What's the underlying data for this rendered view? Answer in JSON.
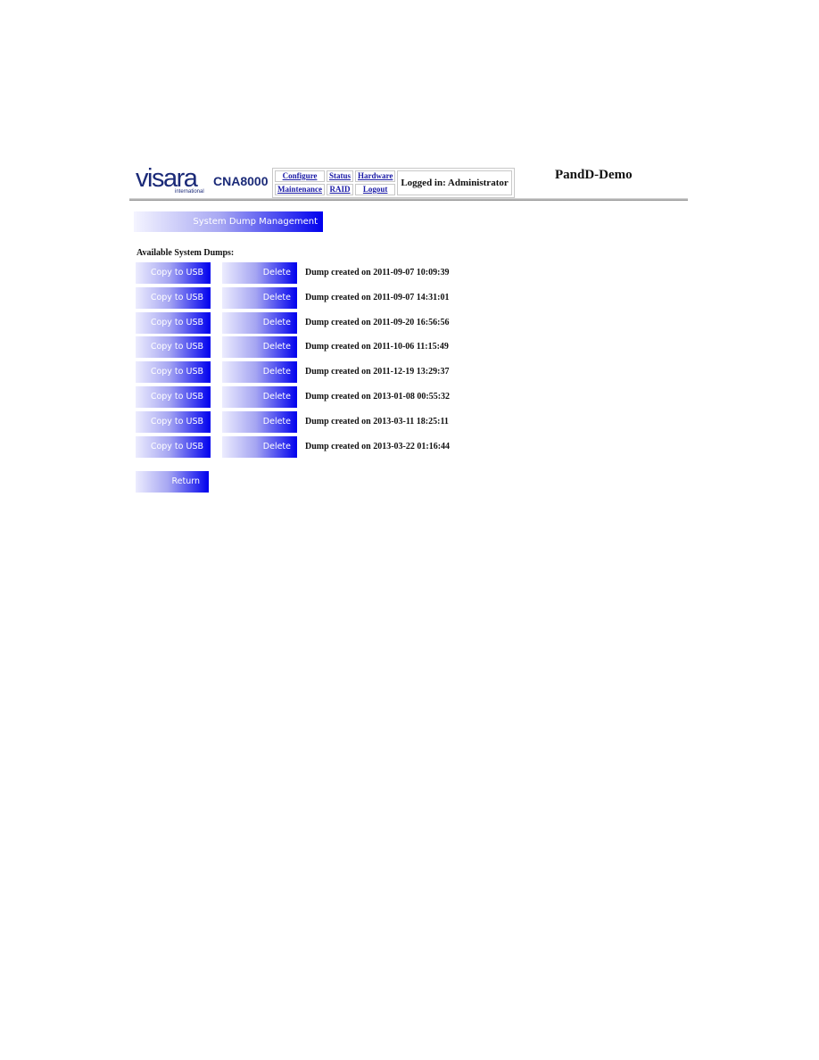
{
  "header": {
    "logo_text": "visara",
    "logo_subtext": "international",
    "product_name": "CNA8000",
    "nav": {
      "row1": [
        "Configure",
        "Status",
        "Hardware"
      ],
      "row2": [
        "Maintenance",
        "RAID",
        "Logout"
      ]
    },
    "login_status": "Logged in: Administrator",
    "hostname": "PandD-Demo"
  },
  "page": {
    "title": "System Dump Management",
    "section_label": "Available System Dumps:",
    "copy_label": "Copy to USB",
    "delete_label": "Delete",
    "return_label": "Return",
    "dumps": [
      {
        "text": "Dump created on 2011-09-07 10:09:39"
      },
      {
        "text": "Dump created on 2011-09-07 14:31:01"
      },
      {
        "text": "Dump created on 2011-09-20 16:56:56"
      },
      {
        "text": "Dump created on 2011-10-06 11:15:49"
      },
      {
        "text": "Dump created on 2011-12-19 13:29:37"
      },
      {
        "text": "Dump created on 2013-01-08 00:55:32"
      },
      {
        "text": "Dump created on 2013-03-11 18:25:11"
      },
      {
        "text": "Dump created on 2013-03-22 01:16:44"
      }
    ]
  },
  "colors": {
    "brand": "#1b2a78",
    "button_gradient_end": "#0000ee",
    "link": "#1a1aa6"
  }
}
